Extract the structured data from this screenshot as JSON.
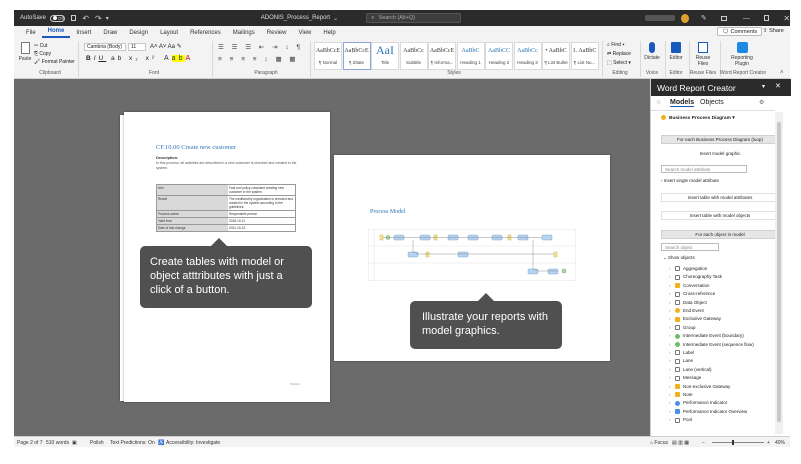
{
  "titlebar": {
    "autosave": "AutoSave",
    "autosave_state": "Off",
    "doc_title": "ADONIS_Process_Report",
    "search_placeholder": "Search (Alt+Q)"
  },
  "tabs": [
    "File",
    "Home",
    "Insert",
    "Draw",
    "Design",
    "Layout",
    "References",
    "Mailings",
    "Review",
    "View",
    "Help"
  ],
  "active_tab": "Home",
  "ribbon_right": {
    "comments": "Comments",
    "share": "Share"
  },
  "ribbon": {
    "clipboard": {
      "paste": "Paste",
      "cut": "Cut",
      "copy": "Copy",
      "format_painter": "Format Painter",
      "label": "Clipboard"
    },
    "font": {
      "family": "Cambria (Body)",
      "size": "11",
      "label": "Font"
    },
    "paragraph": {
      "label": "Paragraph"
    },
    "styles": {
      "label": "Styles",
      "items": [
        {
          "preview": "AaBbCcE",
          "name": "¶ Normal"
        },
        {
          "preview": "AaBbCcE",
          "name": "¶ Zitate"
        },
        {
          "preview": "AaI",
          "name": "Title"
        },
        {
          "preview": "AaBbCc",
          "name": "Subtitle"
        },
        {
          "preview": "AaBbCcE",
          "name": "¶ Informa..."
        },
        {
          "preview": "AaBbC",
          "name": "Heading 1"
        },
        {
          "preview": "AaBbCC",
          "name": "Heading 2"
        },
        {
          "preview": "AaBbCc",
          "name": "Heading 3"
        },
        {
          "preview": "• AaBbC",
          "name": "¶ List Bullet"
        },
        {
          "preview": "1. AaBbC",
          "name": "¶ List Nu..."
        }
      ]
    },
    "editing": {
      "find": "Find",
      "replace": "Replace",
      "select": "Select",
      "label": "Editing"
    },
    "voice": {
      "dictate": "Dictate",
      "label": "Voice"
    },
    "editor": {
      "editor": "Editor",
      "label": "Editor"
    },
    "reuse": {
      "reuse": "Reuse Files",
      "label": "Reuse Files"
    },
    "report": {
      "label1": "Reporting",
      "label2": "Plugin",
      "group": "Word Report Creator"
    }
  },
  "page1": {
    "heading": "CF.10.00 Create new customer",
    "desc_label": "Description:",
    "desc_text": "In this process, all activities are described in a new customer is checked and created in the system.",
    "table": [
      {
        "k": "Aim",
        "v": "Fast and policy compliant creating new customer in the system."
      },
      {
        "k": "Result",
        "v": "The creditworthy organization is checked and created in the system according to the guidelines."
      },
      {
        "k": "Process owner",
        "v": "Responsible person"
      },
      {
        "k": "Valid from",
        "v": "2018-10-11"
      },
      {
        "k": "Date of last change",
        "v": "2021-10-13"
      }
    ],
    "footer": "PAGE 1"
  },
  "page2": {
    "heading": "Process Model"
  },
  "callouts": {
    "left": "Create tables with model or object atttributes with just a click of a button.",
    "right": "Illustrate your reports with model graphics."
  },
  "pane": {
    "title": "Word Report Creator",
    "tab_models": "Models",
    "tab_objects": "Objects",
    "model_type": "Business Process Diagram",
    "btn_foreach_model": "For each Business Process Diagram (loop)",
    "btn_insert_graphic": "Insert model graphic",
    "search_model_attr": "Search model attribute",
    "insert_single": "Insert single model attribute",
    "btn_table_model_attrs": "Insert table with model attributes",
    "btn_table_model_objects": "Insert table with model objects",
    "btn_foreach_object": "For each object in model",
    "search_object": "Search object",
    "show_objects": "Show objects",
    "objects": [
      "Aggregation",
      "Choreography Task",
      "Conversation",
      "Cross-reference",
      "Data Object",
      "End Event",
      "Exclusive Gateway",
      "Group",
      "Intermediate Event (boundary)",
      "Intermediate Event (sequence flow)",
      "Label",
      "Lane",
      "Lane (vertical)",
      "Message",
      "Non-exclusive Gateway",
      "Note",
      "Performance Indicator",
      "Performance Indicator Overview",
      "Pool"
    ]
  },
  "status": {
    "page": "Page 2 of 7",
    "words": "510 words",
    "language": "Polish",
    "predictions": "Text Predictions: On",
    "accessibility": "Accessibility: Investigate",
    "focus": "Focus",
    "zoom": "40%"
  },
  "colors": {
    "accent": "#185abd",
    "heading_blue": "#2e75b6",
    "dark": "#2b2b2b",
    "gray_bg": "#6b6b6b"
  }
}
